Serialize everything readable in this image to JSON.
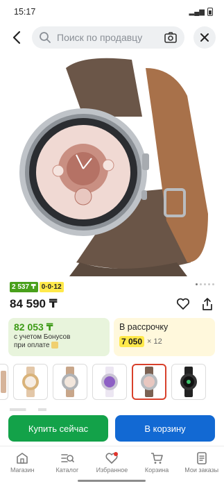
{
  "status": {
    "time": "15:17"
  },
  "search": {
    "placeholder": "Поиск по продавцу"
  },
  "product": {
    "badge_installments": "2 537 ₸",
    "badge_plan": "0·0·12",
    "price": "84 590 ₸"
  },
  "bonus_card": {
    "amount": "82 053 ₸",
    "line1": "с учетом Бонусов",
    "line2": "при оплате"
  },
  "installment_card": {
    "label": "В рассрочку",
    "amount": "7 050",
    "multiplier": "× 12"
  },
  "actions": {
    "buy_now": "Купить сейчас",
    "add_to_cart": "В корзину"
  },
  "nav": {
    "items": [
      {
        "label": "Магазин",
        "icon": "shop-icon"
      },
      {
        "label": "Каталог",
        "icon": "catalog-search-icon"
      },
      {
        "label": "Избранное",
        "icon": "heart-icon"
      },
      {
        "label": "Корзина",
        "icon": "cart-icon"
      },
      {
        "label": "Мои заказы",
        "icon": "orders-icon"
      }
    ]
  },
  "colors": {
    "accent_green": "#13a249",
    "accent_blue": "#1269d3",
    "badge_green": "#49a01b",
    "badge_yellow": "#ffe94a",
    "selected_variant_border": "#d8402b"
  }
}
